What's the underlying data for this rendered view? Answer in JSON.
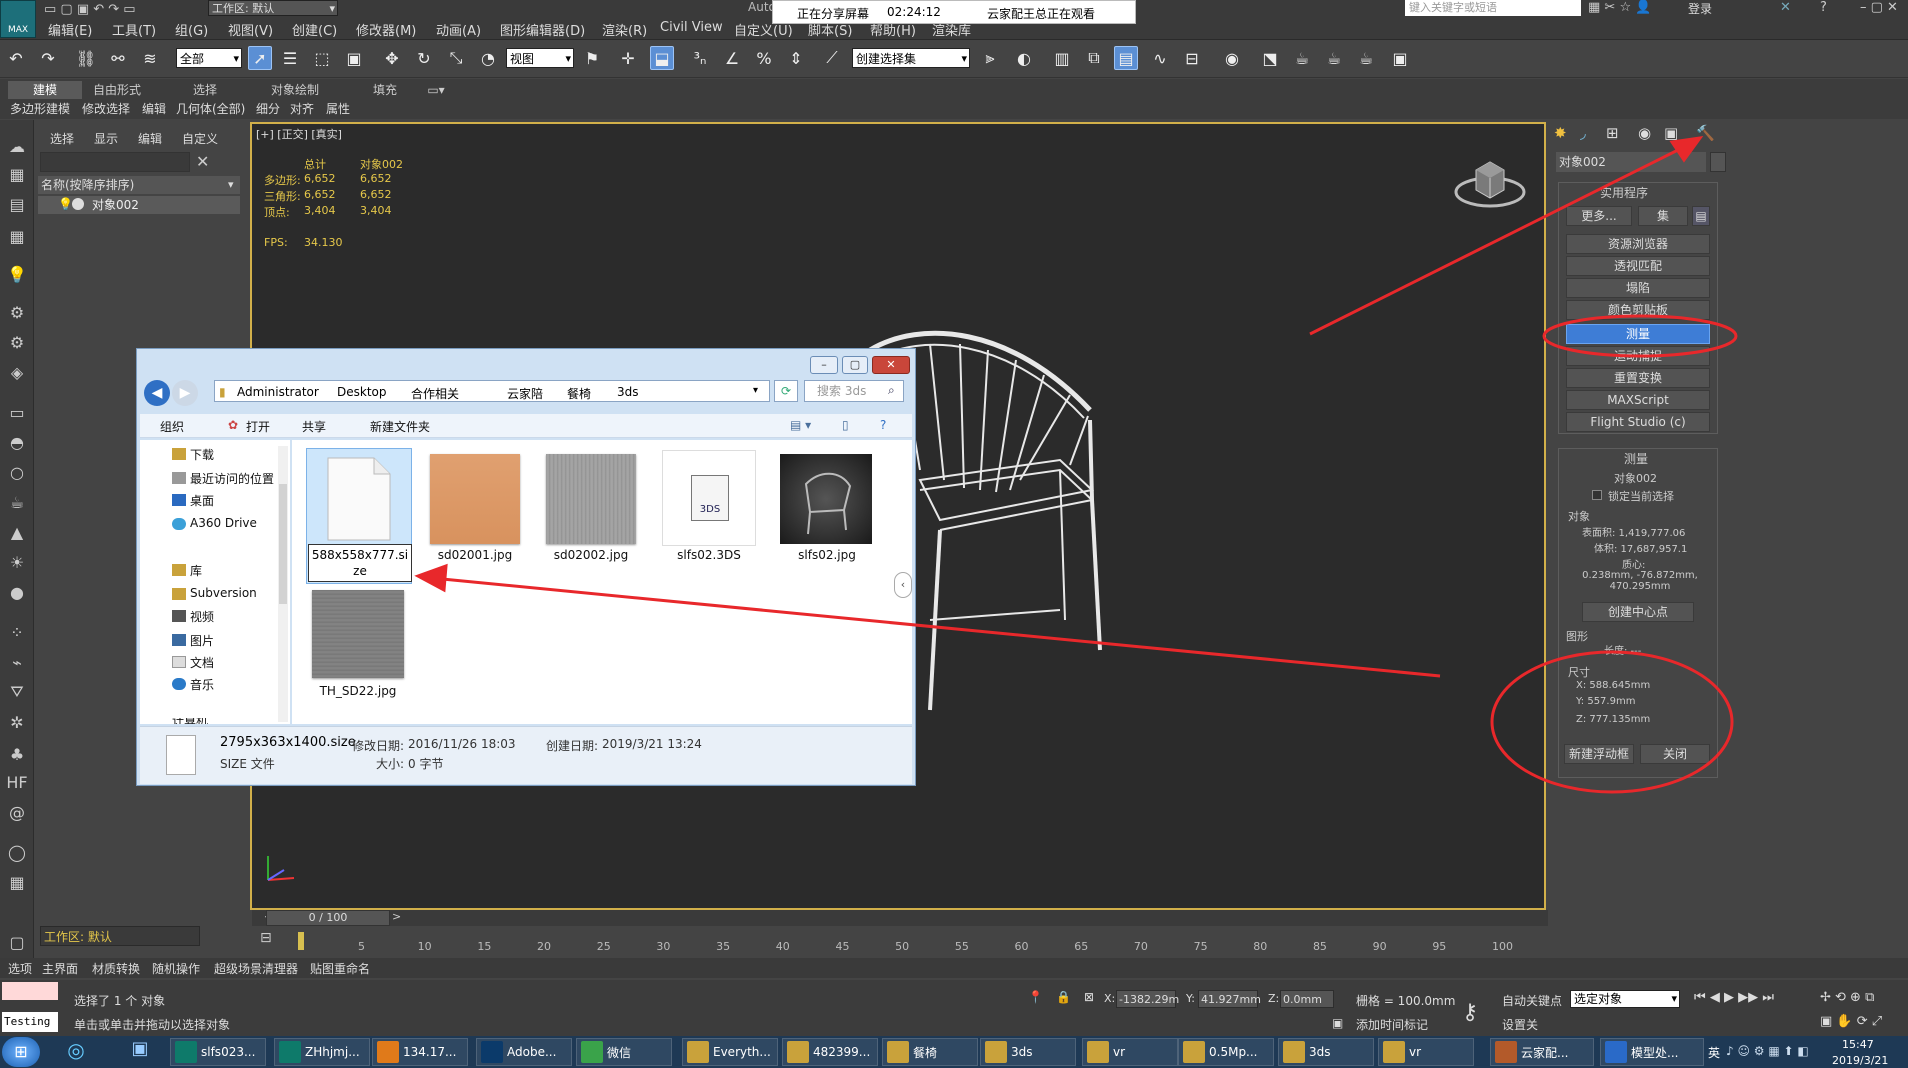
{
  "app": {
    "logo_text": "MAX"
  },
  "menu": {
    "items": [
      "编辑(E)",
      "工具(T)",
      "组(G)",
      "视图(V)",
      "创建(C)",
      "修改器(M)",
      "动画(A)",
      "图形编辑器(D)",
      "渲染(R)",
      "Civil View",
      "自定义(U)",
      "脚本(S)",
      "帮助(H)",
      "渲染库"
    ],
    "workspace_label": "工作区: 默认",
    "search_placeholder": "键入关键字或短语",
    "login": "登录"
  },
  "share_bar": {
    "status": "正在分享屏幕",
    "time": "02:24:12",
    "viewer": "云家配王总正在观看",
    "app_partial": "Auto"
  },
  "toolbar": {
    "selection_filter": "全部",
    "view_dropdown": "视图",
    "selection_set": "创建选择集"
  },
  "ribbon": {
    "tabs": [
      "建模",
      "自由形式",
      "选择",
      "对象绘制",
      "填充"
    ],
    "items": [
      "多边形建模",
      "修改选择",
      "编辑",
      "几何体(全部)",
      "细分",
      "对齐",
      "属性"
    ]
  },
  "scene_explorer": {
    "tabs": [
      "选择",
      "显示",
      "编辑",
      "自定义"
    ],
    "column_header": "名称(按降序排序)",
    "object": "对象002",
    "workspace": "工作区: 默认"
  },
  "viewport": {
    "label": "[+] [正交] [真实]",
    "stats": {
      "col_total": "总计",
      "col_object": "对象002",
      "rows": [
        {
          "label": "多边形:",
          "total": "6,652",
          "object": "6,652"
        },
        {
          "label": "三角形:",
          "total": "6,652",
          "object": "6,652"
        },
        {
          "label": "顶点:",
          "total": "3,404",
          "object": "3,404"
        }
      ],
      "fps_label": "FPS:",
      "fps_value": "34.130"
    }
  },
  "command_panel": {
    "object_name": "对象002",
    "utilities_title": "实用程序",
    "more_button": "更多...",
    "sets_button": "集",
    "utilities": [
      "资源浏览器",
      "透视匹配",
      "塌陷",
      "颜色剪贴板",
      "测量",
      "运动捕捉",
      "重置变换",
      "MAXScript",
      "Flight Studio (c)"
    ],
    "selected_utility": "测量",
    "measure": {
      "title": "测量",
      "object": "对象002",
      "lock_label": "锁定当前选择",
      "objects_group": "对象",
      "surface_area": "表面积: 1,419,777.06",
      "volume": "体积: 17,687,957.1",
      "center_label": "质心:",
      "center_value": "0.238mm, -76.872mm, 470.295mm",
      "create_center": "创建中心点",
      "shapes_group": "图形",
      "length": "长度: ---",
      "dimensions_group": "尺寸",
      "x": "X:  588.645mm",
      "y": "Y:  557.9mm",
      "z": "Z:  777.135mm",
      "new_floater": "新建浮动框",
      "close": "关闭"
    }
  },
  "timeline": {
    "frame": "0 / 100",
    "ticks": [
      "5",
      "10",
      "15",
      "20",
      "25",
      "30",
      "35",
      "40",
      "45",
      "50",
      "55",
      "60",
      "65",
      "70",
      "75",
      "80",
      "85",
      "90",
      "95",
      "100"
    ]
  },
  "bottom_tabs": [
    "选项",
    "主界面",
    "材质转换",
    "随机操作",
    "超级场景清理器",
    "贴图重命名"
  ],
  "status": {
    "selected": "选择了 1 个 对象",
    "hint": "单击或单击并拖动以选择对象",
    "script_box": "Testing f",
    "x": "-1382.29m",
    "y": "41.927mm",
    "z": "0.0mm",
    "grid": "栅格 = 100.0mm",
    "add_time_tag": "添加时间标记",
    "auto_key": "自动关键点",
    "set_key": "设置关",
    "key_filter": "选定对象",
    "x_label": "X:",
    "y_label": "Y:",
    "z_label": "Z:"
  },
  "explorer_window": {
    "path": [
      "Administrator",
      "Desktop",
      "合作相关",
      "云家陪",
      "餐椅",
      "3ds"
    ],
    "search_placeholder": "搜索 3ds",
    "commands": [
      "组织",
      "打开",
      "共享",
      "新建文件夹"
    ],
    "nav": [
      "下载",
      "最近访问的位置",
      "桌面",
      "A360 Drive",
      "库",
      "Subversion",
      "视频",
      "图片",
      "文档",
      "音乐",
      "计算机"
    ],
    "files": [
      {
        "name": "588x558x777.size"
      },
      {
        "name": "sd02001.jpg"
      },
      {
        "name": "sd02002.jpg"
      },
      {
        "name": "slfs02.3DS",
        "icon_text": "3DS"
      },
      {
        "name": "slfs02.jpg"
      },
      {
        "name": "TH_SD22.jpg"
      }
    ],
    "details": {
      "filename": "2795x363x1400.size",
      "modified_label": "修改日期:",
      "modified": "2016/11/26 18:03",
      "created_label": "创建日期:",
      "created": "2019/3/21 13:24",
      "type": "SIZE 文件",
      "size_label": "大小:",
      "size": "0 字节"
    }
  },
  "taskbar": {
    "tasks": [
      "slfs023...",
      "ZHhjmj...",
      "134.17...",
      "Adobe...",
      "微信",
      "Everyth...",
      "482399...",
      "餐椅",
      "3ds",
      "vr",
      "0.5Mp...",
      "3ds",
      "vr",
      "云家配...",
      "模型处..."
    ],
    "ime": "英",
    "time": "15:47",
    "date": "2019/3/21"
  },
  "colors": {
    "accent": "#3e7dd6",
    "viewport_border": "#d2b04a",
    "annotation_red": "#e8282b",
    "stats_yellow": "#e6c84a"
  }
}
